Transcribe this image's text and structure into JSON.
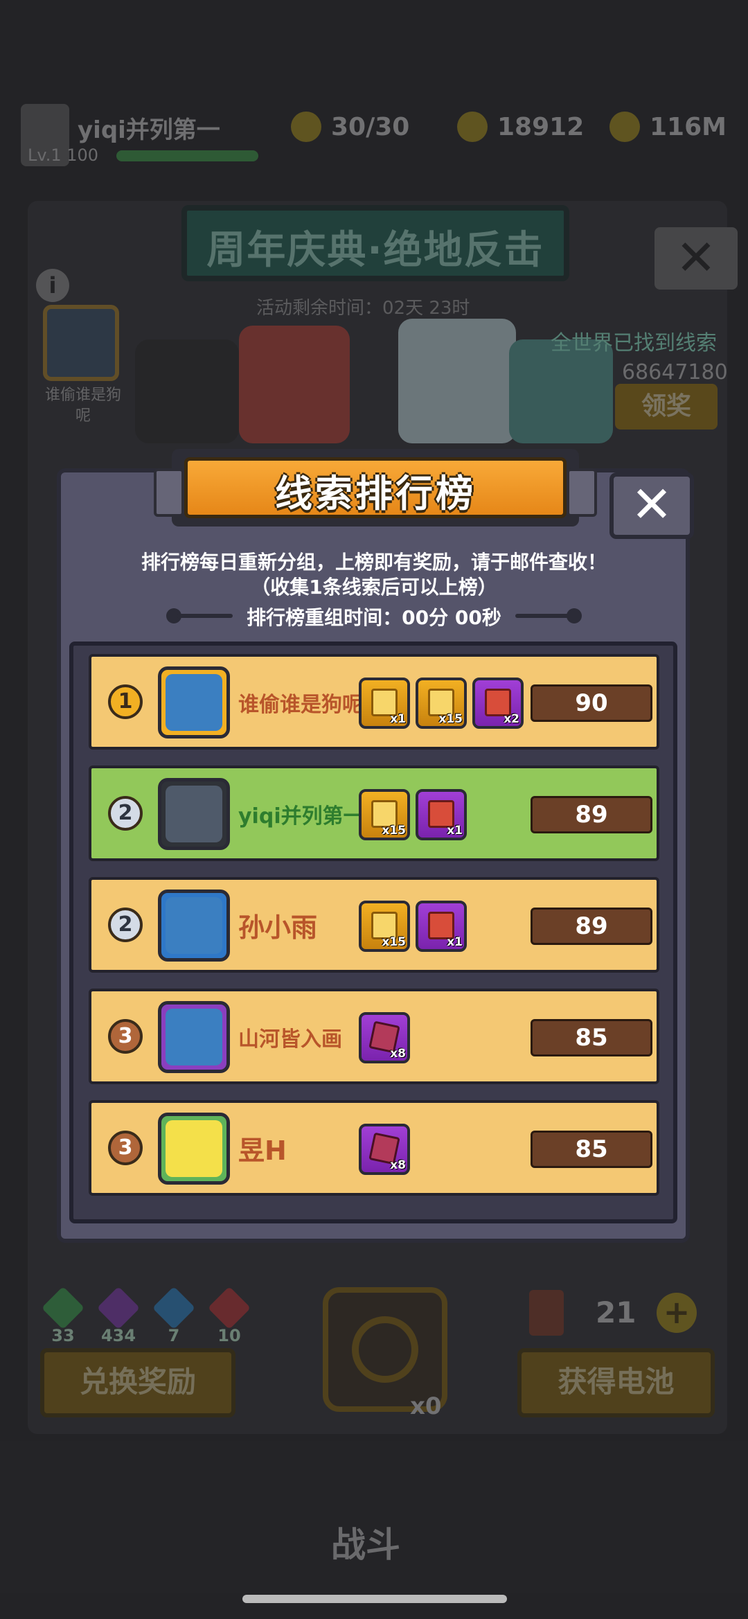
{
  "background": {
    "player": {
      "name": "yiqi并列第一",
      "level": "Lv.1 100"
    },
    "resources": [
      {
        "icon": "energy-icon",
        "value": "30/30"
      },
      {
        "icon": "clue-coin-icon",
        "value": "18912"
      },
      {
        "icon": "gold-coin-icon",
        "value": "116M"
      }
    ],
    "event_title": "周年庆典·绝地反击",
    "event_time": "活动剩余时间：02天 23时",
    "profile_label": "谁偷谁是狗呢",
    "world_clues_label": "全世界已找到线索",
    "world_clues_value": "68647180",
    "claim_button": "领奖",
    "gems": [
      {
        "icon": "green-gem-icon",
        "value": "33",
        "color": "#3fae55"
      },
      {
        "icon": "purple-gem-icon",
        "value": "434",
        "color": "#8a3fbf"
      },
      {
        "icon": "blue-gem-icon",
        "value": "7",
        "color": "#2f8fd8"
      },
      {
        "icon": "red-gem-icon",
        "value": "10",
        "color": "#c8383a"
      }
    ],
    "exchange_button": "兑换奖励",
    "battery_button": "获得电池",
    "battery_count": "21",
    "lock_count": "x0",
    "battle_label": "战斗"
  },
  "modal": {
    "title": "线索排行榜",
    "notice_line1": "排行榜每日重新分组，上榜即有奖励，请于邮件查收！",
    "notice_line2": "（收集1条线索后可以上榜）",
    "reset_time": "排行榜重组时间：00分 00秒",
    "rows": [
      {
        "rank": "1",
        "name": "谁偷谁是狗呢",
        "score": "90",
        "style": "gold",
        "avatar_color": "#3b7fc1",
        "frame": "gold-crown",
        "rewards": [
          {
            "type": "chest",
            "qty": "x1"
          },
          {
            "type": "chest",
            "qty": "x15"
          },
          {
            "type": "gift",
            "qty": "x2"
          }
        ]
      },
      {
        "rank": "2",
        "name": "yiqi并列第一",
        "score": "89",
        "style": "green",
        "avatar_color": "#4f5a6a",
        "frame": "plain",
        "rewards": [
          {
            "type": "chest",
            "qty": "x15"
          },
          {
            "type": "gift",
            "qty": "x1"
          }
        ]
      },
      {
        "rank": "2",
        "name": "孙小雨",
        "score": "89",
        "style": "gold",
        "avatar_color": "#3b7fc1",
        "frame": "star",
        "rewards": [
          {
            "type": "chest",
            "qty": "x15"
          },
          {
            "type": "gift",
            "qty": "x1"
          }
        ]
      },
      {
        "rank": "3",
        "name": "山河皆入画",
        "score": "85",
        "style": "gold",
        "avatar_color": "#7a4fc1",
        "frame": "clover",
        "rewards": [
          {
            "type": "puzzle",
            "qty": "x8"
          }
        ]
      },
      {
        "rank": "3",
        "name": "昱H",
        "score": "85",
        "style": "gold",
        "avatar_color": "#58b35a",
        "frame": "flower",
        "rewards": [
          {
            "type": "puzzle",
            "qty": "x8"
          }
        ]
      }
    ]
  }
}
